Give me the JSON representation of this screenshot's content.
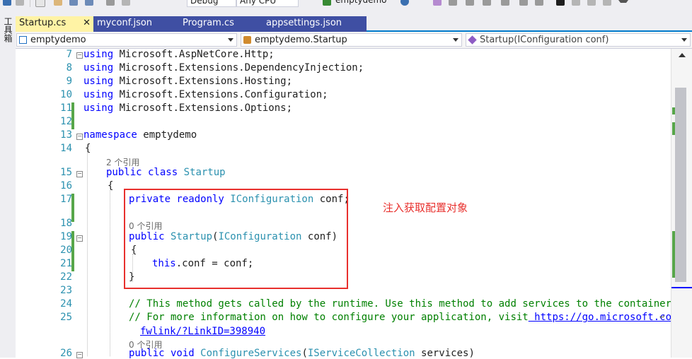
{
  "toolbar": {
    "config": "Debug",
    "platform": "Any CPU",
    "run_target": "emptydemo"
  },
  "left_strip": {
    "toolbox_label": "工具箱"
  },
  "tabs": [
    {
      "label": "Startup.cs",
      "active": true,
      "closable": true
    },
    {
      "label": "myconf.json",
      "active": false,
      "pinned": true
    },
    {
      "label": "Program.cs",
      "active": false
    },
    {
      "label": "appsettings.json",
      "active": false
    }
  ],
  "nav": {
    "project": "emptydemo",
    "type": "emptydemo.Startup",
    "member": "Startup(IConfiguration conf)"
  },
  "code": {
    "lines": [
      {
        "n": "7",
        "tokens": [
          [
            "kw",
            "using"
          ],
          [
            "",
            "Microsoft.AspNetCore.Http;"
          ]
        ]
      },
      {
        "n": "8",
        "tokens": [
          [
            "kw",
            "using"
          ],
          [
            "",
            "Microsoft.Extensions.DependencyInjection;"
          ]
        ]
      },
      {
        "n": "9",
        "tokens": [
          [
            "kw",
            "using"
          ],
          [
            "",
            "Microsoft.Extensions.Hosting;"
          ]
        ]
      },
      {
        "n": "10",
        "tokens": [
          [
            "kw",
            "using"
          ],
          [
            "",
            "Microsoft.Extensions.Configuration;"
          ]
        ]
      },
      {
        "n": "11",
        "tokens": [
          [
            "kw",
            "using"
          ],
          [
            "",
            "Microsoft.Extensions.Options;"
          ]
        ]
      },
      {
        "n": "12",
        "tokens": []
      },
      {
        "n": "13",
        "tokens": [
          [
            "kw",
            "namespace"
          ],
          [
            "",
            "emptydemo"
          ]
        ]
      },
      {
        "n": "14",
        "tokens": [
          [
            "",
            "{"
          ]
        ]
      },
      {
        "n": "15",
        "tokens": [
          [
            "kw",
            "public class"
          ],
          [
            "ty",
            "Startup"
          ]
        ]
      },
      {
        "n": "16",
        "tokens": [
          [
            "",
            "{"
          ]
        ]
      },
      {
        "n": "17",
        "tokens": [
          [
            "kw",
            "private readonly"
          ],
          [
            "ty",
            "IConfiguration"
          ],
          [
            "",
            "conf;"
          ]
        ]
      },
      {
        "n": "18",
        "tokens": []
      },
      {
        "n": "19",
        "tokens": [
          [
            "kw",
            "public"
          ],
          [
            "ty",
            "Startup"
          ],
          [
            "",
            "("
          ],
          [
            "ty",
            "IConfiguration"
          ],
          [
            "",
            "conf)"
          ]
        ]
      },
      {
        "n": "20",
        "tokens": [
          [
            "",
            "{"
          ]
        ]
      },
      {
        "n": "21",
        "tokens": [
          [
            "kw",
            "this"
          ],
          [
            "",
            ".conf = conf;"
          ]
        ]
      },
      {
        "n": "22",
        "tokens": [
          [
            "",
            "}"
          ]
        ]
      },
      {
        "n": "23",
        "tokens": []
      },
      {
        "n": "24",
        "tokens": [
          [
            "cm",
            "// This method gets called by the runtime. Use this method to add services to the container."
          ]
        ]
      },
      {
        "n": "25",
        "tokens": [
          [
            "cm",
            "// For more information on how to configure your application, visit"
          ],
          [
            "link",
            "https://go.microsoft.com/"
          ]
        ]
      },
      {
        "n": "",
        "tokens": [
          [
            "link",
            "fwlink/?LinkID=398940"
          ]
        ]
      },
      {
        "n": "26",
        "tokens": [
          [
            "kw",
            "public void"
          ],
          [
            "ty",
            "ConfigureServices"
          ],
          [
            "",
            "("
          ],
          [
            "ty",
            "IServiceCollection"
          ],
          [
            "",
            "services)"
          ]
        ]
      }
    ],
    "codelens": [
      "2 个引用",
      "0 个引用",
      "0 个引用"
    ],
    "wrap_glyph": "↩"
  },
  "annotation": {
    "text": "注入获取配置对象",
    "color": "#e8302d"
  },
  "colors": {
    "accent": "#007acc",
    "active_tab": "#fff3a5",
    "change_bar": "#57a64a"
  }
}
